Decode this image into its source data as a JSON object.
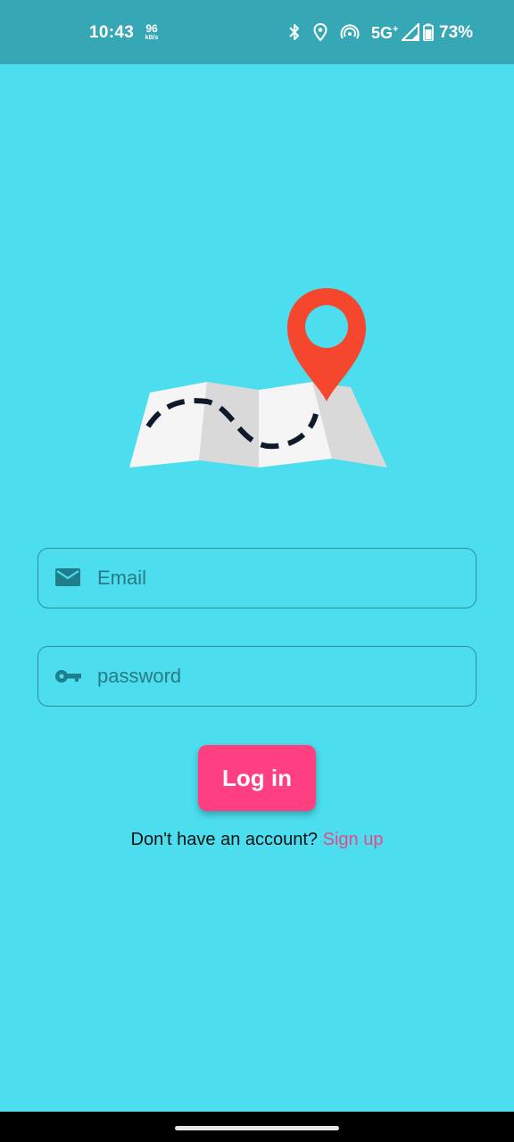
{
  "status_bar": {
    "time": "10:43",
    "net_speed": "96",
    "net_speed_unit": "kB/s",
    "network": "5G",
    "network_super": "+",
    "battery": "73%",
    "icons": [
      "bluetooth-icon",
      "location-icon",
      "hotspot-icon",
      "signal-icon",
      "battery-icon"
    ]
  },
  "illustration": {
    "name": "map-with-location-pin",
    "colors": {
      "pin": "#f4472d",
      "map_light": "#f5f5f5",
      "map_dark": "#d9d9d9",
      "route": "#0e1a2b"
    }
  },
  "form": {
    "email": {
      "placeholder": "Email",
      "value": "",
      "icon": "mail-icon"
    },
    "password": {
      "placeholder": "password",
      "value": "",
      "icon": "key-icon"
    },
    "login_label": "Log in"
  },
  "signup": {
    "prompt": "Don't have an account?",
    "link_label": "Sign up"
  },
  "colors": {
    "background": "#4cdeee",
    "status_bar": "#36a7b4",
    "button": "#ff3f82",
    "link": "#e24a8b",
    "field_border": "#2a8f9a"
  }
}
